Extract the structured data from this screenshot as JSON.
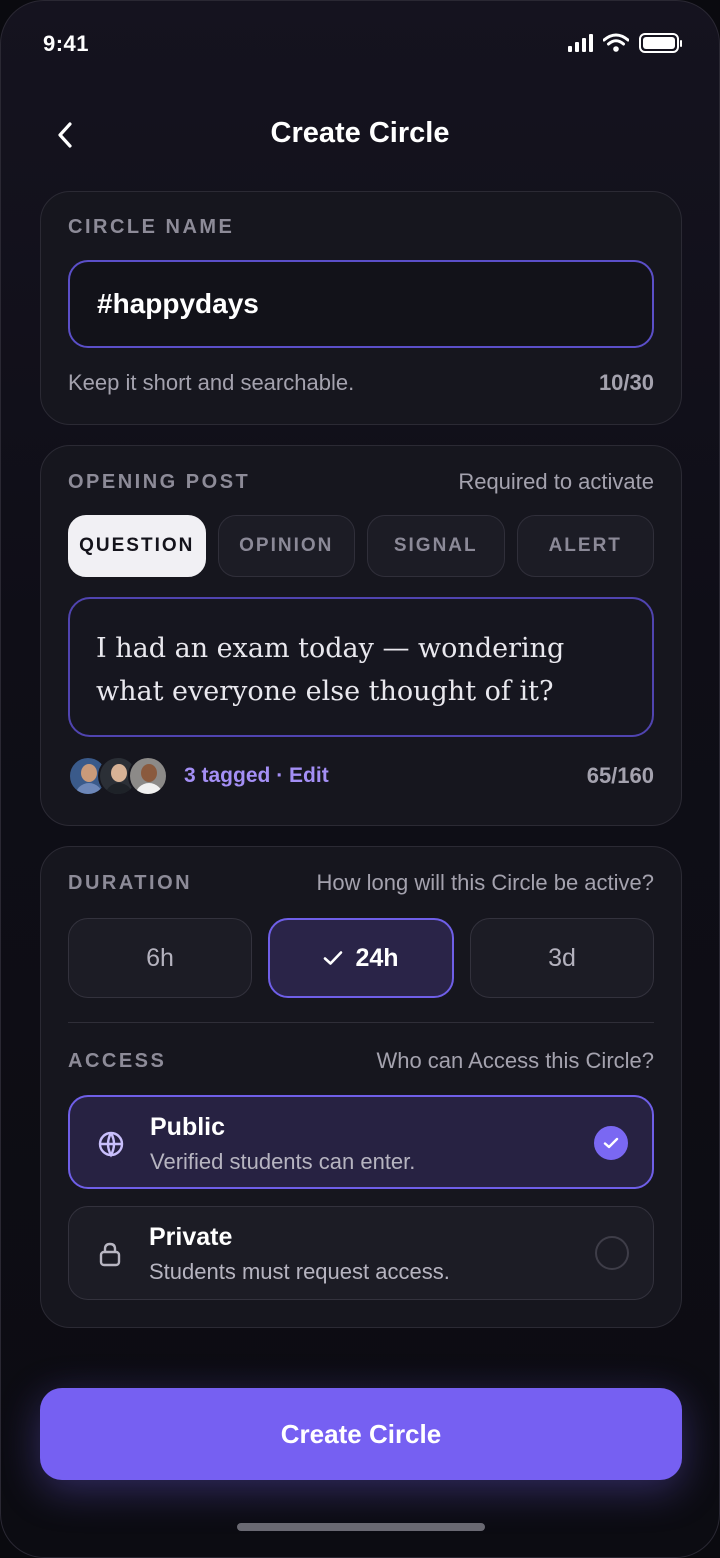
{
  "status_bar": {
    "time": "9:41"
  },
  "header": {
    "title": "Create Circle"
  },
  "circle_name": {
    "label": "CIRCLE NAME",
    "value": "#happydays",
    "helper": "Keep it short and searchable.",
    "counter": "10/30"
  },
  "opening_post": {
    "label": "OPENING POST",
    "hint": "Required to activate",
    "types": [
      {
        "label": "QUESTION",
        "selected": true
      },
      {
        "label": "OPINION",
        "selected": false
      },
      {
        "label": "SIGNAL",
        "selected": false
      },
      {
        "label": "ALERT",
        "selected": false
      }
    ],
    "text": "I had an exam today — wondering what everyone else thought of it?",
    "tagged_count": "3 tagged",
    "separator": "·",
    "edit_label": "Edit",
    "counter": "65/160"
  },
  "duration": {
    "label": "DURATION",
    "hint": "How long will this Circle be active?",
    "options": [
      {
        "label": "6h",
        "selected": false
      },
      {
        "label": "24h",
        "selected": true
      },
      {
        "label": "3d",
        "selected": false
      }
    ]
  },
  "access": {
    "label": "ACCESS",
    "hint": "Who can Access this Circle?",
    "options": [
      {
        "title": "Public",
        "description": "Verified students can enter.",
        "icon": "globe-icon",
        "selected": true
      },
      {
        "title": "Private",
        "description": "Students must request access.",
        "icon": "lock-icon",
        "selected": false
      }
    ]
  },
  "cta": {
    "label": "Create Circle"
  },
  "colors": {
    "accent": "#7660f2",
    "background": "#0f0e17",
    "card": "#16161e"
  }
}
